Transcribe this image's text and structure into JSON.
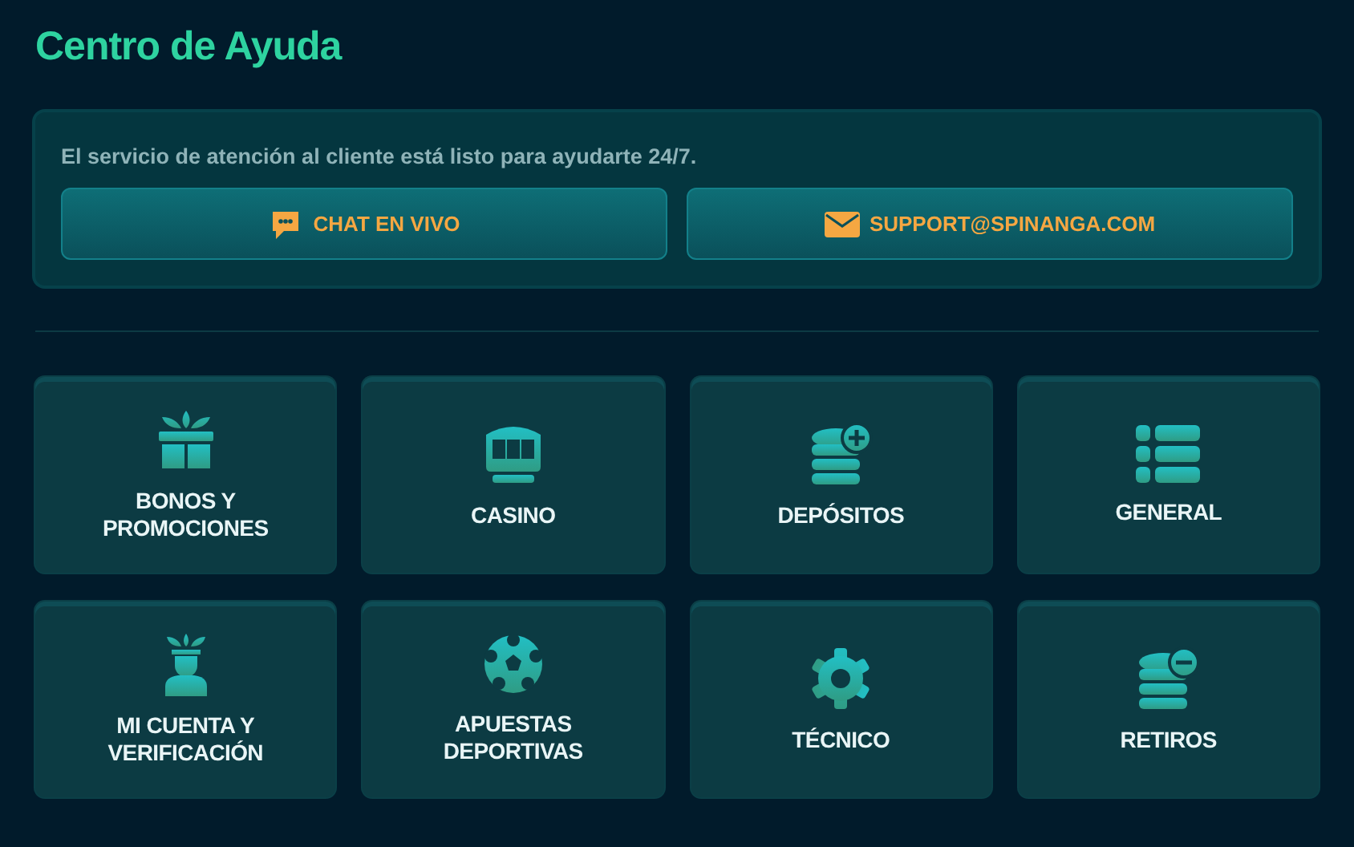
{
  "title": "Centro de Ayuda",
  "contact": {
    "message": "El servicio de atención al cliente está listo para ayudarte 24/7.",
    "buttons": [
      {
        "kind": "chat",
        "label": "CHAT EN VIVO"
      },
      {
        "kind": "email",
        "label": "SUPPORT@SPINANGA.COM"
      }
    ]
  },
  "categories": [
    {
      "kind": "gift",
      "label": "BONOS Y PROMOCIONES"
    },
    {
      "kind": "slot",
      "label": "CASINO"
    },
    {
      "kind": "deposit",
      "label": "DEPÓSITOS"
    },
    {
      "kind": "list",
      "label": "GENERAL"
    },
    {
      "kind": "account",
      "label": "MI CUENTA Y VERIFICACIÓN"
    },
    {
      "kind": "ball",
      "label": "APUESTAS DEPORTIVAS"
    },
    {
      "kind": "gear",
      "label": "TÉCNICO"
    },
    {
      "kind": "withdraw",
      "label": "RETIROS"
    }
  ]
}
